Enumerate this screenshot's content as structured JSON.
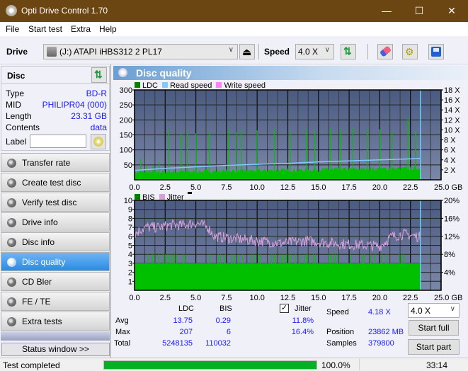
{
  "window": {
    "title": "Opti Drive Control 1.70",
    "minimize": "—",
    "maximize": "☐",
    "close": "✕"
  },
  "menu": [
    "File",
    "Start test",
    "Extra",
    "Help"
  ],
  "toolbar": {
    "drive_label": "Drive",
    "drive_value": "(J:)  ATAPI iHBS312   2 PL17",
    "speed_label": "Speed",
    "speed_value": "4.0 X"
  },
  "disc": {
    "title": "Disc",
    "rows": [
      {
        "key": "Type",
        "value": "BD-R"
      },
      {
        "key": "MID",
        "value": "PHILIPR04 (000)"
      },
      {
        "key": "Length",
        "value": "23.31 GB"
      },
      {
        "key": "Contents",
        "value": "data"
      }
    ],
    "label_key": "Label",
    "label_value": ""
  },
  "nav": [
    {
      "label": "Transfer rate",
      "active": false
    },
    {
      "label": "Create test disc",
      "active": false
    },
    {
      "label": "Verify test disc",
      "active": false
    },
    {
      "label": "Drive info",
      "active": false
    },
    {
      "label": "Disc info",
      "active": false
    },
    {
      "label": "Disc quality",
      "active": true
    },
    {
      "label": "CD Bler",
      "active": false
    },
    {
      "label": "FE / TE",
      "active": false
    },
    {
      "label": "Extra tests",
      "active": false
    }
  ],
  "status_window_label": "Status window >>",
  "panel_title": "Disc quality",
  "colors": {
    "ldc": "#00c000",
    "read_speed": "#80c8ff",
    "write_speed": "#ff80ff",
    "bis": "#00c000",
    "jitter": "#d8a0d8",
    "plot_bg_top": "#4a5a80",
    "plot_bg_bottom": "#7a88a8",
    "accent_blue": "#1a1aff",
    "progress": "#06b025"
  },
  "chart_data": [
    {
      "type": "bar",
      "title": "LDC / Read speed",
      "legend": [
        "LDC",
        "Read speed",
        "Write speed"
      ],
      "legend_position": "top-left",
      "xlabel": "GB",
      "x_ticks": [
        "0.0",
        "2.5",
        "5.0",
        "7.5",
        "10.0",
        "12.5",
        "15.0",
        "17.5",
        "20.0",
        "22.5",
        "25.0 GB"
      ],
      "xlim": [
        0,
        25
      ],
      "y_left_ticks": [
        "300",
        "250",
        "200",
        "150",
        "100",
        "50"
      ],
      "ylim_left": [
        0,
        300
      ],
      "y_right_ticks": [
        "18 X",
        "16 X",
        "14 X",
        "12 X",
        "10 X",
        "8 X",
        "6 X",
        "4 X",
        "2 X"
      ],
      "ylim_right": [
        0,
        18
      ],
      "grid": true,
      "end_marker_gb": 23.31,
      "ldc_baseline_approx": 25,
      "ldc_spikes": [
        {
          "x": 0.5,
          "y": 70
        },
        {
          "x": 1.0,
          "y": 50
        },
        {
          "x": 1.5,
          "y": 45
        },
        {
          "x": 2.0,
          "y": 60
        },
        {
          "x": 2.8,
          "y": 165
        },
        {
          "x": 3.8,
          "y": 155
        },
        {
          "x": 4.3,
          "y": 158
        },
        {
          "x": 5.0,
          "y": 155
        },
        {
          "x": 6.1,
          "y": 158
        },
        {
          "x": 7.7,
          "y": 165
        },
        {
          "x": 8.3,
          "y": 160
        },
        {
          "x": 8.7,
          "y": 168
        },
        {
          "x": 10.0,
          "y": 165
        },
        {
          "x": 11.4,
          "y": 170
        },
        {
          "x": 12.7,
          "y": 160
        },
        {
          "x": 14.0,
          "y": 168
        },
        {
          "x": 14.7,
          "y": 162
        },
        {
          "x": 16.0,
          "y": 172
        },
        {
          "x": 16.8,
          "y": 165
        },
        {
          "x": 17.8,
          "y": 175
        },
        {
          "x": 19.0,
          "y": 170
        },
        {
          "x": 20.0,
          "y": 168
        },
        {
          "x": 21.0,
          "y": 160
        },
        {
          "x": 22.3,
          "y": 207
        },
        {
          "x": 22.9,
          "y": 160
        }
      ],
      "read_speed": {
        "x": [
          0,
          2.5,
          5,
          7.5,
          10,
          12.5,
          15,
          17.5,
          20,
          22.5,
          23.31
        ],
        "y": [
          1.9,
          2.3,
          2.6,
          2.9,
          3.1,
          3.3,
          3.6,
          3.8,
          4.0,
          4.2,
          4.3
        ]
      }
    },
    {
      "type": "bar",
      "title": "BIS / Jitter",
      "legend": [
        "BIS",
        "Jitter"
      ],
      "legend_position": "top-left",
      "xlabel": "GB",
      "x_ticks": [
        "0.0",
        "2.5",
        "5.0",
        "7.5",
        "10.0",
        "12.5",
        "15.0",
        "17.5",
        "20.0",
        "22.5",
        "25.0 GB"
      ],
      "xlim": [
        0,
        25
      ],
      "y_left_ticks": [
        "10",
        "9",
        "8",
        "7",
        "6",
        "5",
        "4",
        "3",
        "2",
        "1"
      ],
      "ylim_left": [
        0,
        10
      ],
      "y_right_ticks": [
        "20%",
        "16%",
        "12%",
        "8%",
        "4%"
      ],
      "ylim_right": [
        0,
        20
      ],
      "grid": true,
      "end_marker_gb": 23.31,
      "bis_baseline_approx": 3,
      "bis_max": 6,
      "jitter": {
        "x": [
          0,
          0.5,
          1,
          2,
          3,
          4,
          5,
          6,
          6.5,
          8,
          10,
          12,
          14,
          16,
          17.5,
          19,
          20,
          21,
          22,
          23.31
        ],
        "y": [
          12.5,
          13.5,
          14,
          14,
          14.5,
          14.5,
          15,
          14,
          12,
          11.5,
          11,
          10.5,
          11,
          10.5,
          10.2,
          10,
          9.8,
          12,
          12.5,
          11.8
        ]
      }
    }
  ],
  "stats": {
    "col_ldc": "LDC",
    "col_bis": "BIS",
    "jitter_label": "Jitter",
    "jitter_checked": true,
    "rows": [
      {
        "label": "Avg",
        "ldc": "13.75",
        "bis": "0.29",
        "jitter": "11.8%"
      },
      {
        "label": "Max",
        "ldc": "207",
        "bis": "6",
        "jitter": "16.4%"
      },
      {
        "label": "Total",
        "ldc": "5248135",
        "bis": "110032",
        "jitter": ""
      }
    ],
    "speed_label": "Speed",
    "speed_value": "4.18 X",
    "speed_select": "4.0 X",
    "position_label": "Position",
    "position_value": "23862 MB",
    "samples_label": "Samples",
    "samples_value": "379800",
    "start_full": "Start full",
    "start_part": "Start part"
  },
  "statusbar": {
    "text": "Test completed",
    "progress": 100.0,
    "progress_text": "100.0%",
    "time": "33:14"
  }
}
